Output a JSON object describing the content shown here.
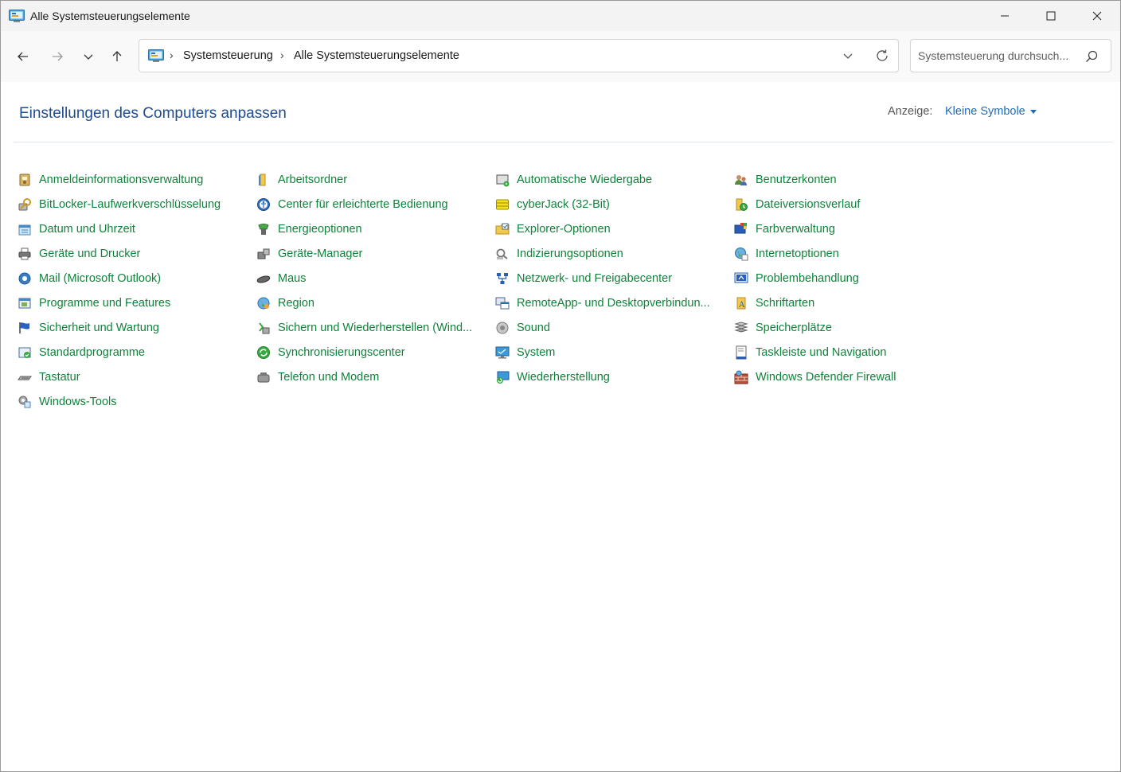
{
  "window": {
    "title": "Alle Systemsteuerungselemente"
  },
  "nav": {
    "breadcrumbs": [
      "Systemsteuerung",
      "Alle Systemsteuerungselemente"
    ],
    "search_placeholder": "Systemsteuerung durchsuch..."
  },
  "header": {
    "title": "Einstellungen des Computers anpassen",
    "view_label": "Anzeige:",
    "view_value": "Kleine Symbole"
  },
  "colors": {
    "link": "#10823b",
    "title": "#1e4d8f",
    "accent": "#1e6bb8"
  },
  "columns": [
    [
      {
        "label": "Anmeldeinformationsverwaltung",
        "icon": "credential-icon"
      },
      {
        "label": "BitLocker-Laufwerkverschlüsselung",
        "icon": "bitlocker-icon"
      },
      {
        "label": "Datum und Uhrzeit",
        "icon": "clock-icon"
      },
      {
        "label": "Geräte und Drucker",
        "icon": "printer-icon"
      },
      {
        "label": "Mail (Microsoft Outlook)",
        "icon": "mail-icon"
      },
      {
        "label": "Programme und Features",
        "icon": "programs-icon"
      },
      {
        "label": "Sicherheit und Wartung",
        "icon": "flag-icon"
      },
      {
        "label": "Standardprogramme",
        "icon": "default-programs-icon"
      },
      {
        "label": "Tastatur",
        "icon": "keyboard-icon"
      },
      {
        "label": "Windows-Tools",
        "icon": "tools-icon"
      }
    ],
    [
      {
        "label": "Arbeitsordner",
        "icon": "work-folder-icon"
      },
      {
        "label": "Center für erleichterte Bedienung",
        "icon": "accessibility-icon"
      },
      {
        "label": "Energieoptionen",
        "icon": "power-icon"
      },
      {
        "label": "Geräte-Manager",
        "icon": "device-manager-icon"
      },
      {
        "label": "Maus",
        "icon": "mouse-icon"
      },
      {
        "label": "Region",
        "icon": "globe-icon"
      },
      {
        "label": "Sichern und Wiederherstellen (Wind...",
        "icon": "backup-icon"
      },
      {
        "label": "Synchronisierungscenter",
        "icon": "sync-icon"
      },
      {
        "label": "Telefon und Modem",
        "icon": "phone-icon"
      }
    ],
    [
      {
        "label": "Automatische Wiedergabe",
        "icon": "autoplay-icon"
      },
      {
        "label": "cyberJack  (32-Bit)",
        "icon": "card-reader-icon"
      },
      {
        "label": "Explorer-Optionen",
        "icon": "folder-options-icon"
      },
      {
        "label": "Indizierungsoptionen",
        "icon": "indexing-icon"
      },
      {
        "label": "Netzwerk- und Freigabecenter",
        "icon": "network-icon"
      },
      {
        "label": "RemoteApp- und Desktopverbindun...",
        "icon": "remoteapp-icon"
      },
      {
        "label": "Sound",
        "icon": "speaker-icon"
      },
      {
        "label": "System",
        "icon": "monitor-icon"
      },
      {
        "label": "Wiederherstellung",
        "icon": "recovery-icon"
      }
    ],
    [
      {
        "label": "Benutzerkonten",
        "icon": "users-icon"
      },
      {
        "label": "Dateiversionsverlauf",
        "icon": "file-history-icon"
      },
      {
        "label": "Farbverwaltung",
        "icon": "color-management-icon"
      },
      {
        "label": "Internetoptionen",
        "icon": "internet-icon"
      },
      {
        "label": "Problembehandlung",
        "icon": "troubleshoot-icon"
      },
      {
        "label": "Schriftarten",
        "icon": "fonts-icon"
      },
      {
        "label": "Speicherplätze",
        "icon": "storage-icon"
      },
      {
        "label": "Taskleiste und Navigation",
        "icon": "taskbar-icon"
      },
      {
        "label": "Windows Defender Firewall",
        "icon": "firewall-icon"
      }
    ]
  ]
}
